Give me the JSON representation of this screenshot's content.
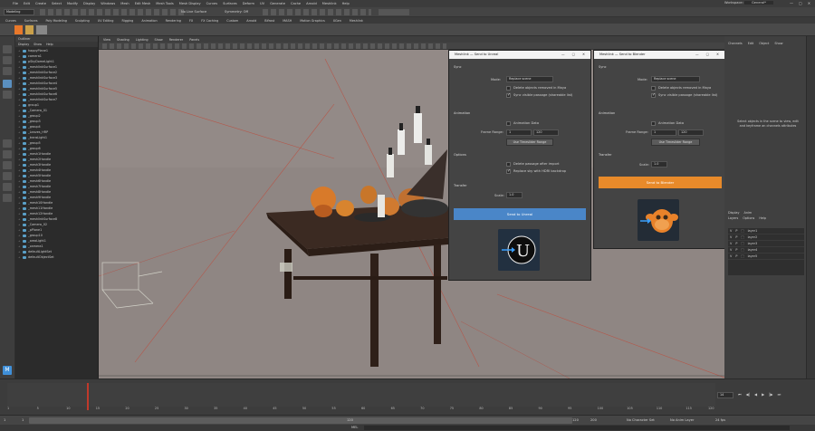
{
  "menu": [
    "File",
    "Edit",
    "Create",
    "Select",
    "Modify",
    "Display",
    "Windows",
    "Mesh",
    "Edit Mesh",
    "Mesh Tools",
    "Mesh Display",
    "Curves",
    "Surfaces",
    "Deform",
    "UV",
    "Generate",
    "Cache",
    "Arnold",
    "Meshlink",
    "Help"
  ],
  "workspace_label": "Workspace:",
  "workspace_value": "General*",
  "mode_select": "Modeling",
  "no_live_surface": "No Live Surface",
  "symmetry": "Symmetry: Off",
  "shelf_tabs": [
    "Curves",
    "Surfaces",
    "Poly Modeling",
    "Sculpting",
    "UV Editing",
    "Rigging",
    "Animation",
    "Rendering",
    "FX",
    "FX Caching",
    "Custom",
    "Arnold",
    "Bifrost",
    "MASH",
    "Motion Graphics",
    "XGen",
    "Meshlink"
  ],
  "outliner": {
    "title": "Outliner",
    "menu": [
      "Display",
      "Show",
      "Help"
    ],
    "items": [
      "happyPlane1",
      "camera1",
      "pSkyDomeLight1",
      "_meshlinkSurface1",
      "_meshlinkSurface2",
      "_meshlinkSurface3",
      "_meshlinkSurface4",
      "_meshlinkSurface5",
      "_meshlinkSurface6",
      "_meshlinkSurface7",
      "group1",
      "_Camera_01",
      "_group2",
      "_group3",
      "_group4",
      "_Leaves_HRP",
      "_transLight1",
      "_group5",
      "_group6",
      "_mesh1Handle",
      "_mesh2Handle",
      "_mesh3Handle",
      "_mesh4Handle",
      "_mesh5Handle",
      "_mesh6Handle",
      "_mesh7Handle",
      "_mesh8Handle",
      "_mesh9Handle",
      "_mesh10Handle",
      "_mesh11Handle",
      "_mesh12Handle",
      "_meshlinkSurface8",
      "_Camera_02",
      "_pPlane1",
      "_group10",
      "_areaLight1",
      "_camera1",
      "defaultLightSet",
      "defaultObjectSet"
    ]
  },
  "viewport_menu": [
    "View",
    "Shading",
    "Lighting",
    "Show",
    "Renderer",
    "Panels"
  ],
  "unreal_window": {
    "title": "Meshlink — Send to Unreal",
    "sync_section": "Sync",
    "mode_label": "Mode:",
    "mode_value": "Replace scene",
    "opt1": "Delete objects removed in Maya",
    "opt2": "Sync visible passage (shareable list)",
    "anim_section": "Animation",
    "anim_data": "Animation Data",
    "frame_range_label": "Frame Range:",
    "frame_start": "1",
    "frame_end": "120",
    "timeslider_btn": "Use Timeslider Range",
    "options_section": "Options",
    "opt3": "Delete passage after import",
    "opt4": "Replace sky with HDRI backdrop",
    "transfer_section": "Transfer",
    "scale_label": "Scale:",
    "scale_value": "1.0",
    "send_button": "Send to Unreal",
    "accent": "#4a86c8"
  },
  "blender_window": {
    "title": "Meshlink — Send to Blender",
    "sync_section": "Sync",
    "mode_label": "Mode:",
    "mode_value": "Replace scene",
    "opt1": "Delete objects removed in Maya",
    "opt2": "Sync visible passage (shareable list)",
    "anim_section": "Animation",
    "anim_data": "Animation Data",
    "frame_range_label": "Frame Range:",
    "frame_start": "1",
    "frame_end": "120",
    "timeslider_btn": "Use Timeslider Range",
    "transfer_section": "Transfer",
    "scale_label": "Scale:",
    "scale_value": "1.0",
    "send_button": "Send to Blender",
    "accent": "#e88a2a"
  },
  "right_panel": {
    "tabs": [
      "Channels",
      "Edit",
      "Object",
      "Show"
    ],
    "hint": "Select objects in the scene to view, edit and keyframe an channels attributes",
    "layer_tabs": [
      "Display",
      "Anim"
    ],
    "layer_menu": [
      "Layers",
      "Options",
      "Help"
    ],
    "layers": [
      "layer1",
      "layer2",
      "layer3",
      "layer4",
      "layer5"
    ]
  },
  "timeline": {
    "current_frame": "14",
    "ticks": [
      "1",
      "5",
      "10",
      "15",
      "20",
      "25",
      "30",
      "35",
      "40",
      "45",
      "50",
      "55",
      "60",
      "65",
      "70",
      "75",
      "80",
      "85",
      "90",
      "95",
      "100",
      "105",
      "110",
      "115",
      "120"
    ]
  },
  "range": {
    "start": "1",
    "start2": "1",
    "end": "120",
    "end2": "120",
    "end3": "200",
    "character_set": "No Character Set",
    "anim_layer": "No Anim Layer",
    "fps": "24 fps"
  },
  "cmd": {
    "lang": "MEL"
  }
}
